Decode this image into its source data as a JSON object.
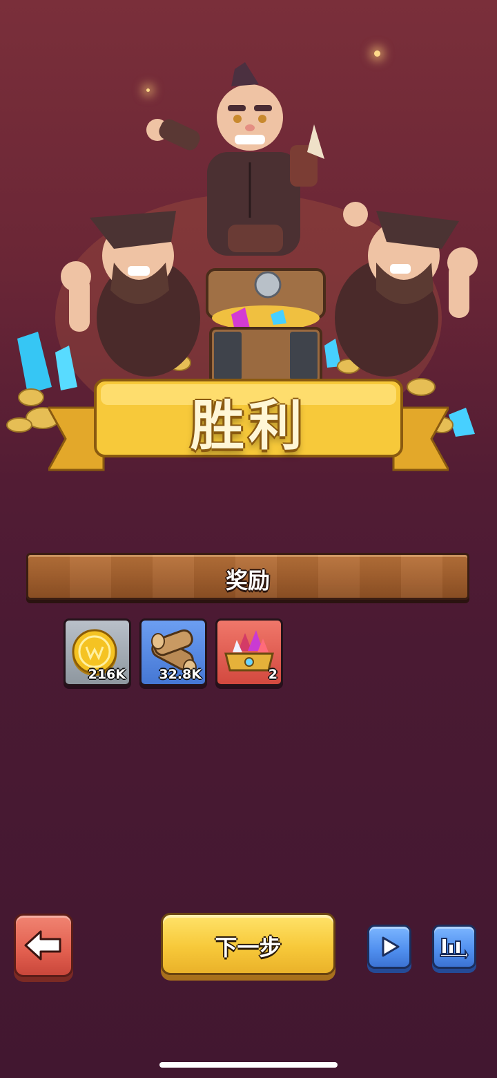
{
  "result": {
    "title": "胜利"
  },
  "rewards": {
    "title": "奖励",
    "items": [
      {
        "icon": "gold-coin-icon",
        "amount": "216K"
      },
      {
        "icon": "wood-logs-icon",
        "amount": "32.8K"
      },
      {
        "icon": "gem-chest-icon",
        "amount": "2"
      }
    ]
  },
  "buttons": {
    "back_icon": "arrow-left-icon",
    "next_label": "下一步",
    "play_icon": "play-icon",
    "stats_icon": "bar-chart-icon"
  },
  "colors": {
    "background_top": "#7a2f3a",
    "background_bottom": "#421730",
    "banner_gold": "#f7c93a",
    "back_button": "#e25f4f",
    "blue_button": "#4f8eee"
  }
}
